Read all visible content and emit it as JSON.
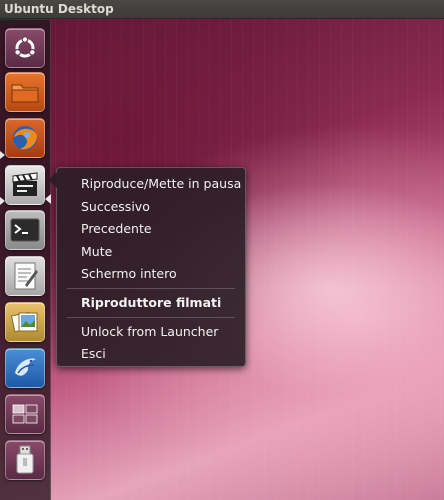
{
  "top_panel": {
    "title": "Ubuntu Desktop"
  },
  "launcher": {
    "items": [
      {
        "name": "dash-home",
        "icon": "ubuntu-logo-icon"
      },
      {
        "name": "home-folder",
        "icon": "folder-icon"
      },
      {
        "name": "firefox",
        "icon": "firefox-icon"
      },
      {
        "name": "movie-player",
        "icon": "clapperboard-icon"
      },
      {
        "name": "terminal",
        "icon": "terminal-icon"
      },
      {
        "name": "text-editor",
        "icon": "text-editor-icon"
      },
      {
        "name": "image-viewer",
        "icon": "photos-icon"
      },
      {
        "name": "thunderbird",
        "icon": "bird-icon"
      },
      {
        "name": "workspace-switcher",
        "icon": "workspaces-icon"
      },
      {
        "name": "usb-drive",
        "icon": "usb-drive-icon"
      }
    ]
  },
  "quicklist": {
    "items": [
      {
        "label": "Riproduce/Mette in pausa"
      },
      {
        "label": "Successivo"
      },
      {
        "label": "Precedente"
      },
      {
        "label": "Mute"
      },
      {
        "label": "Schermo intero"
      }
    ],
    "app_title": "Riproduttore filmati",
    "unlock_label": "Unlock from Launcher",
    "quit_label": "Esci"
  }
}
